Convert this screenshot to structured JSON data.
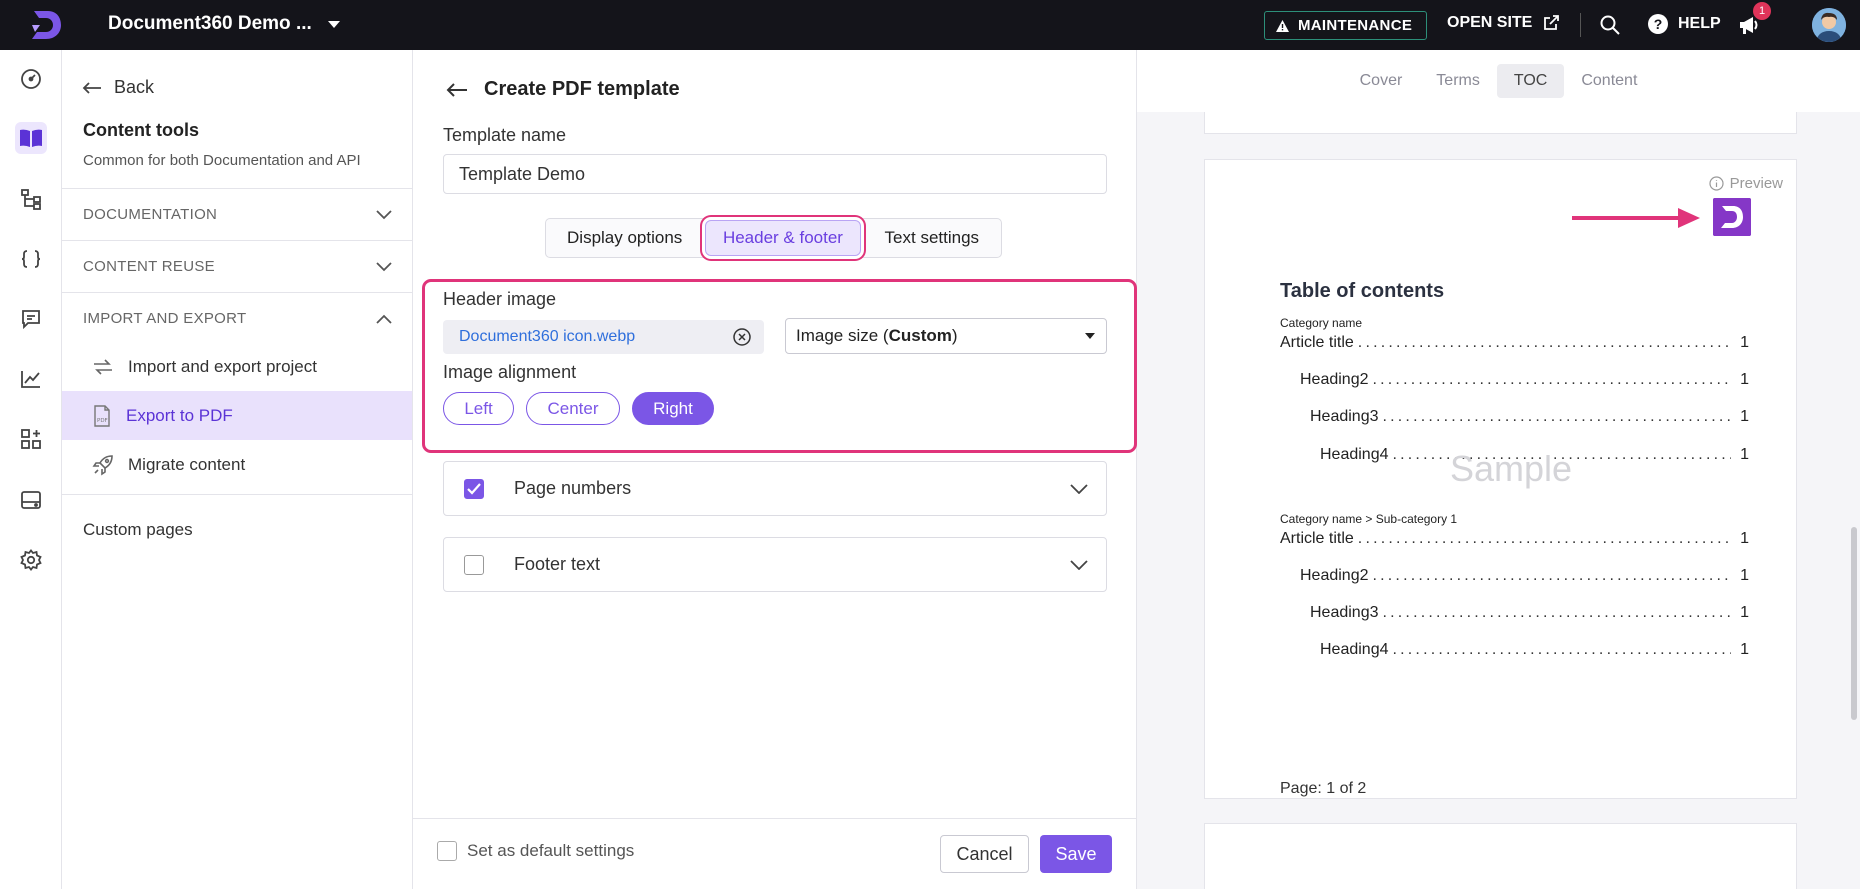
{
  "topbar": {
    "project_name": "Document360 Demo ...",
    "maintenance_label": "MAINTENANCE",
    "open_site_label": "OPEN SITE",
    "help_label": "HELP",
    "notification_count": "1"
  },
  "sidebar": {
    "back_label": "Back",
    "title": "Content tools",
    "subtitle": "Common for both Documentation and API",
    "sections": [
      {
        "label": "DOCUMENTATION"
      },
      {
        "label": "CONTENT REUSE"
      },
      {
        "label": "IMPORT AND EXPORT"
      }
    ],
    "items": [
      {
        "label": "Import and export project",
        "icon": "import-export-icon"
      },
      {
        "label": "Export to PDF",
        "icon": "pdf-icon"
      },
      {
        "label": "Migrate content",
        "icon": "rocket-icon"
      }
    ],
    "custom_pages_label": "Custom pages"
  },
  "form": {
    "heading": "Create PDF template",
    "template_name_label": "Template name",
    "template_name_value": "Template Demo",
    "tabs": [
      {
        "label": "Display options"
      },
      {
        "label": "Header & footer"
      },
      {
        "label": "Text settings"
      }
    ],
    "header_image_label": "Header image",
    "file_name": "Document360 icon.webp",
    "image_size_prefix": "Image size (",
    "image_size_value": "Custom",
    "image_size_suffix": ")",
    "image_alignment_label": "Image alignment",
    "alignment_options": [
      {
        "label": "Left"
      },
      {
        "label": "Center"
      },
      {
        "label": "Right"
      }
    ],
    "selected_alignment": "Right",
    "page_numbers_label": "Page numbers",
    "footer_text_label": "Footer text",
    "default_settings_label": "Set as default settings",
    "cancel_label": "Cancel",
    "save_label": "Save"
  },
  "preview": {
    "tabs": [
      {
        "label": "Cover"
      },
      {
        "label": "Terms"
      },
      {
        "label": "TOC"
      },
      {
        "label": "Content"
      }
    ],
    "active_tab": "TOC",
    "preview_label": "Preview",
    "toc_title": "Table of contents",
    "groups": [
      {
        "category": "Category name",
        "rows": [
          {
            "label": "Article title",
            "page": "1"
          },
          {
            "label": "Heading2",
            "page": "1"
          },
          {
            "label": "Heading3",
            "page": "1"
          },
          {
            "label": "Heading4",
            "page": "1"
          }
        ]
      },
      {
        "category": "Category name > Sub-category 1",
        "rows": [
          {
            "label": "Article title",
            "page": "1"
          },
          {
            "label": "Heading2",
            "page": "1"
          },
          {
            "label": "Heading3",
            "page": "1"
          },
          {
            "label": "Heading4",
            "page": "1"
          }
        ]
      }
    ],
    "watermark": "Sample",
    "page_number": "Page: 1 of 2"
  },
  "colors": {
    "accent": "#7b56e6",
    "highlight": "#e0347a",
    "topbar": "#14141a"
  }
}
